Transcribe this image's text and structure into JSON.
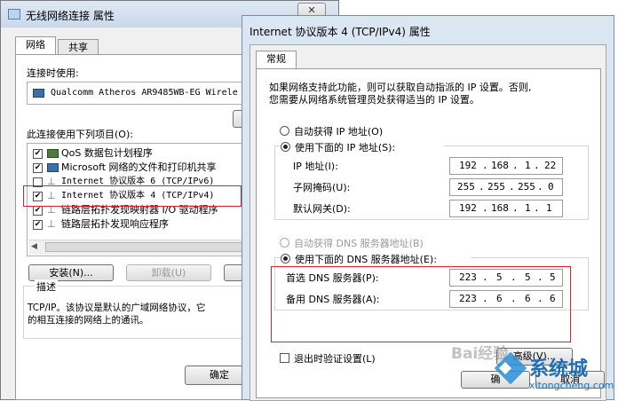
{
  "back_window": {
    "title": "无线网络连接 属性",
    "tabs": [
      {
        "label": "网络"
      },
      {
        "label": "共享"
      }
    ],
    "connect_using_label": "连接时使用:",
    "adapter_name": "Qualcomm Atheros AR9485WB-EG Wirele",
    "items_label": "此连接使用下列项目(O):",
    "items": [
      {
        "label": "QoS 数据包计划程序",
        "checked": true
      },
      {
        "label": "Microsoft 网络的文件和打印机共享",
        "checked": true
      },
      {
        "label": "Internet 协议版本 6 (TCP/IPv6)",
        "checked": false
      },
      {
        "label": "Internet 协议版本 4 (TCP/IPv4)",
        "checked": true
      },
      {
        "label": "链路层拓扑发现映射器 I/O 驱动程序",
        "checked": true
      },
      {
        "label": "链路层拓扑发现响应程序",
        "checked": true
      }
    ],
    "install_button": "安装(N)...",
    "uninstall_button": "卸载(U)",
    "description_label": "描述",
    "description_text_1": "TCP/IP。该协议是默认的广域网络协议，它",
    "description_text_2": "的相互连接的网络上的通讯。",
    "ok_button": "确定"
  },
  "front_window": {
    "title": "Internet 协议版本 4 (TCP/IPv4) 属性",
    "tab": "常规",
    "intro_line_1": "如果网络支持此功能，则可以获取自动指派的 IP 设置。否则,",
    "intro_line_2": "您需要从网络系统管理员处获得适当的 IP 设置。",
    "auto_ip_label": "自动获得 IP 地址(O)",
    "use_ip_label": "使用下面的 IP 地址(S):",
    "ip_label": "IP 地址(I):",
    "ip_value": [
      "192",
      "168",
      "1",
      "22"
    ],
    "subnet_label": "子网掩码(U):",
    "subnet_value": [
      "255",
      "255",
      "255",
      "0"
    ],
    "gateway_label": "默认网关(D):",
    "gateway_value": [
      "192",
      "168",
      "1",
      "1"
    ],
    "auto_dns_label": "自动获得 DNS 服务器地址(B)",
    "use_dns_label": "使用下面的 DNS 服务器地址(E):",
    "preferred_dns_label": "首选 DNS 服务器(P):",
    "preferred_dns_value": [
      "223",
      "5",
      "5",
      "5"
    ],
    "alternate_dns_label": "备用 DNS 服务器(A):",
    "alternate_dns_value": [
      "223",
      "6",
      "6",
      "6"
    ],
    "validate_label": "退出时验证设置(L)",
    "advanced_button": "高级(V)...",
    "ok_button": "确",
    "cancel_button": "取消"
  },
  "watermark": {
    "site": "系统城",
    "url": "xitongcheng.com",
    "baidu": "Bai经验"
  },
  "colors": {
    "highlight_red": "#d0262f",
    "title_blue": "#dbe6f3"
  }
}
